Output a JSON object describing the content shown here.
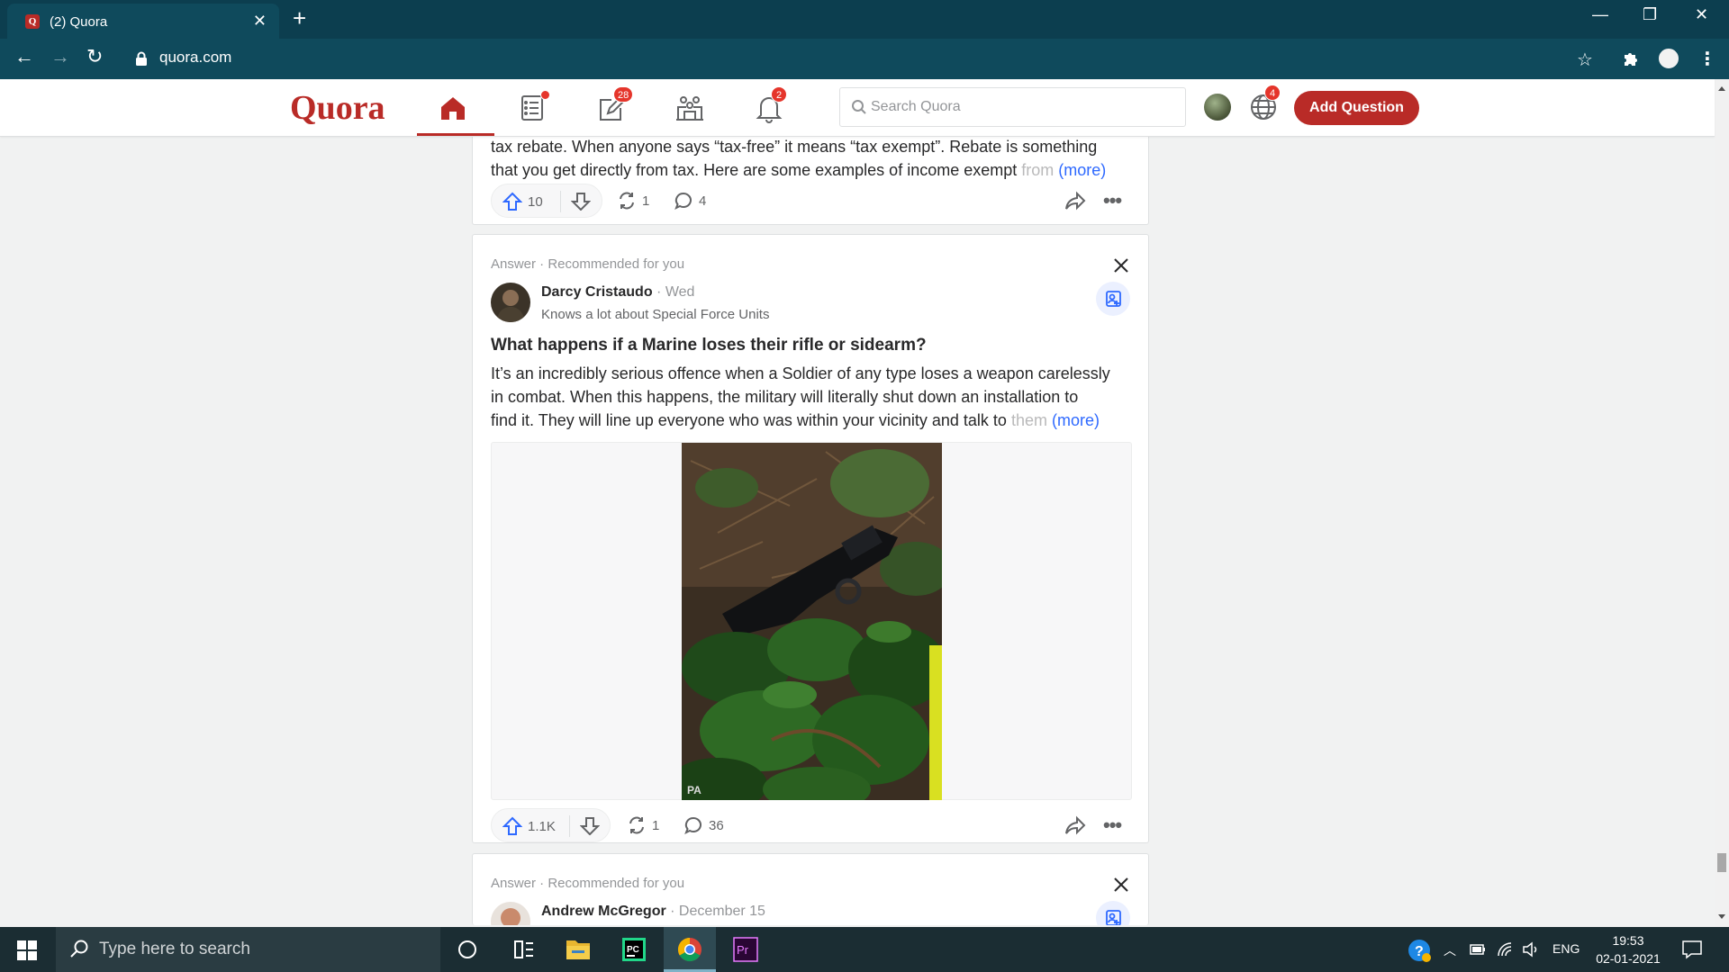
{
  "browser": {
    "tab_title": "(2) Quora",
    "url": "quora.com",
    "favicon_letter": "Q"
  },
  "header": {
    "logo": "Quora",
    "badges": {
      "answer": "28",
      "notifications": "2",
      "language": "4"
    },
    "search_placeholder": "Search Quora",
    "add_question_label": "Add Question",
    "accent_color": "#b92b27"
  },
  "card1": {
    "text_line1": "tax rebate. When anyone says “tax-free” it means “tax exempt”. Rebate is something",
    "text_line2": "that you get directly from tax. Here are some examples of income exempt ",
    "text_fade": "from",
    "more": "(more)",
    "upvotes": "10",
    "shares": "1",
    "comments": "4"
  },
  "card2": {
    "meta": "Answer · Recommended for you",
    "author": "Darcy Cristaudo",
    "date": " · Wed",
    "credential": "Knows a lot about Special Force Units",
    "question": "What happens if a Marine loses their rifle or sidearm?",
    "text_line1": "It’s an incredibly serious offence when a Soldier of any type loses a weapon carelessly",
    "text_line2": "in combat. When this happens, the military will literally shut down an installation to",
    "text_line3": "find it. They will line up everyone who was within your vicinity and talk to ",
    "text_fade": "them",
    "more": "(more)",
    "image_watermark": "PA",
    "upvotes": "1.1K",
    "shares": "1",
    "comments": "36"
  },
  "card3": {
    "meta": "Answer · Recommended for you",
    "author": "Andrew McGregor",
    "date": " · December 15"
  },
  "taskbar": {
    "search_placeholder": "Type here to search",
    "lang": "ENG",
    "time": "19:53",
    "date": "02-01-2021"
  }
}
